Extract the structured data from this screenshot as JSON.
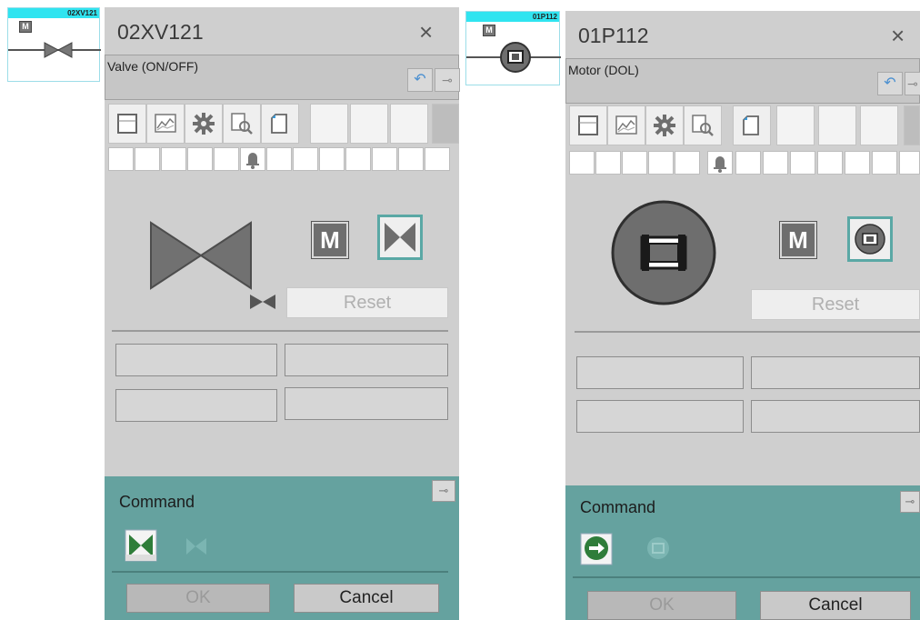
{
  "valve_symbol": {
    "tag": "02XV121",
    "mode_letter": "M"
  },
  "motor_symbol": {
    "tag": "01P112",
    "mode_letter": "M"
  },
  "valve_faceplate": {
    "title": "02XV121",
    "close": "×",
    "type_label": "Valve (ON/OFF)",
    "mode_letter": "M",
    "reset_label": "Reset",
    "command_label": "Command",
    "ok_label": "OK",
    "cancel_label": "Cancel"
  },
  "motor_faceplate": {
    "title": "01P112",
    "close": "×",
    "type_label": "Motor (DOL)",
    "mode_letter": "M",
    "reset_label": "Reset",
    "command_label": "Command",
    "ok_label": "OK",
    "cancel_label": "Cancel"
  },
  "colors": {
    "panel": "#cfcfcf",
    "command_panel": "#65a29f",
    "symbol_tag": "#30e4f0",
    "mode_selected_border": "#5aa8a5",
    "command_green": "#2f7d3a"
  },
  "icons": [
    "back-arrow-icon",
    "pin-icon",
    "faceplate-icon",
    "trend-icon",
    "gear-icon",
    "search-doc-icon",
    "note-icon",
    "bell-icon"
  ]
}
